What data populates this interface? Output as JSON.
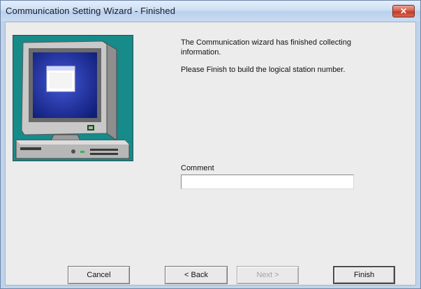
{
  "window": {
    "title": "Communication Setting Wizard - Finished",
    "close_glyph": "✕"
  },
  "message": {
    "line1": "The Communication wizard has finished collecting",
    "line2": "information.",
    "line3": "Please Finish to build the logical station number."
  },
  "comment": {
    "label": "Comment",
    "value": "",
    "placeholder": ""
  },
  "buttons": {
    "cancel": "Cancel",
    "back": "< Back",
    "next": "Next >",
    "finish": "Finish"
  },
  "icons": {
    "illustration": "computer-monitor-icon",
    "close": "close-icon"
  },
  "colors": {
    "title_bar": "#c9dcf2",
    "close_button": "#d4503c",
    "illustration_bg": "#178a8a",
    "dialog_bg": "#ececec"
  }
}
